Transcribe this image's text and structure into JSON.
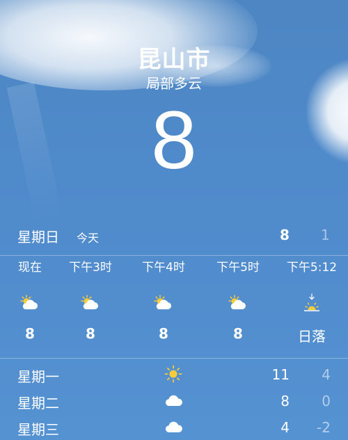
{
  "location": {
    "city": "昆山市",
    "condition": "局部多云",
    "temperature": "8"
  },
  "today": {
    "day": "星期日",
    "label": "今天",
    "high": "8",
    "low": "1"
  },
  "hourly": [
    {
      "time": "现在",
      "icon": "partly-cloudy-icon",
      "temp": "8"
    },
    {
      "time": "下午3时",
      "icon": "partly-cloudy-icon",
      "temp": "8"
    },
    {
      "time": "下午4时",
      "icon": "partly-cloudy-icon",
      "temp": "8"
    },
    {
      "time": "下午5时",
      "icon": "partly-cloudy-icon",
      "temp": "8"
    },
    {
      "time": "下午5:12",
      "icon": "sunset-icon",
      "temp": "日落"
    }
  ],
  "daily": [
    {
      "day": "星期一",
      "icon": "sun-icon",
      "high": "11",
      "low": "4"
    },
    {
      "day": "星期二",
      "icon": "cloud-icon",
      "high": "8",
      "low": "0"
    },
    {
      "day": "星期三",
      "icon": "cloud-icon",
      "high": "4",
      "low": "-2"
    }
  ],
  "colors": {
    "sky": "#4f8acb",
    "sun": "#f7cc3a",
    "cloud": "#ffffff"
  }
}
